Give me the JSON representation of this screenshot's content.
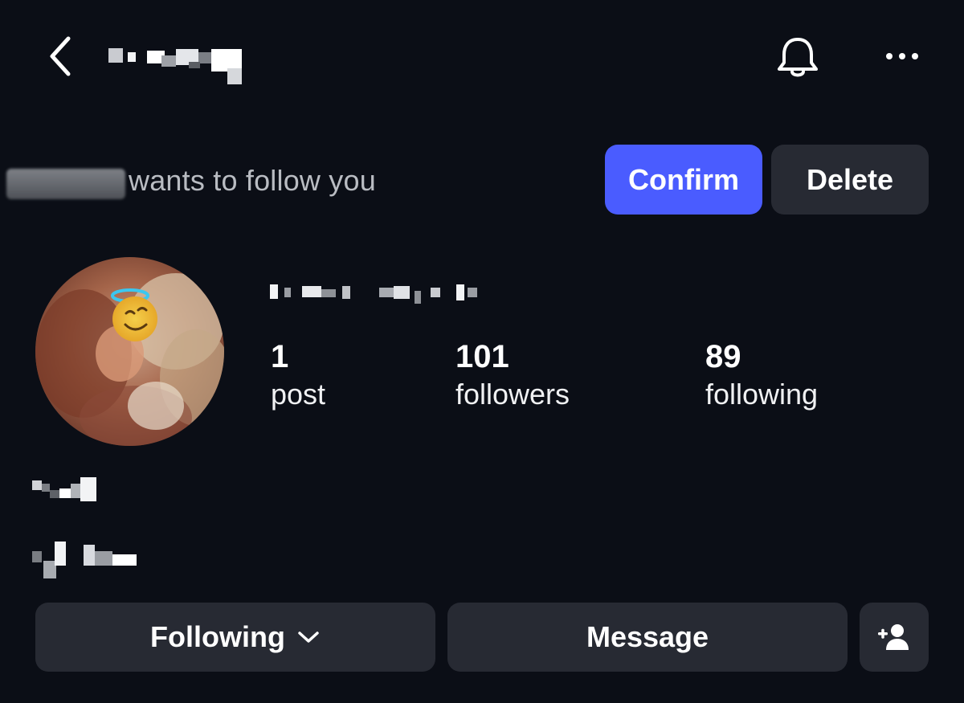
{
  "header": {
    "back_icon": "chevron-left-icon",
    "username": "",
    "notifications_icon": "bell-icon",
    "more_icon": "more-horizontal-icon"
  },
  "follow_request": {
    "text": "wants to follow you",
    "confirm_label": "Confirm",
    "delete_label": "Delete",
    "confirm_color": "#4a5cff",
    "delete_color": "#272a33"
  },
  "profile": {
    "display_name": "",
    "stats": [
      {
        "value": "1",
        "label": "post"
      },
      {
        "value": "101",
        "label": "followers"
      },
      {
        "value": "89",
        "label": "following"
      }
    ]
  },
  "actions": {
    "following_label": "Following",
    "message_label": "Message",
    "add_user_icon": "person-add-icon"
  },
  "colors": {
    "background": "#0b0e16",
    "button_bg": "#272a33",
    "accent": "#4a5cff",
    "text_primary": "#ffffff",
    "text_secondary": "#b9bcc2"
  }
}
